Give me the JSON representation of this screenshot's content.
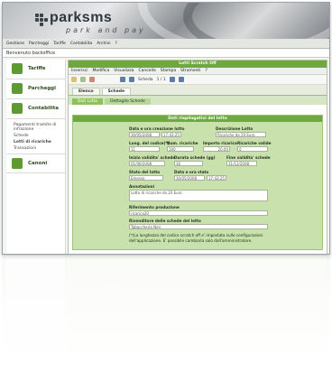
{
  "app": {
    "brand_name": "parksms",
    "tagline": "park and pay",
    "welcome": "Benvenuto backoffice"
  },
  "menubar": {
    "items": [
      "Gestione",
      "Parcheggi",
      "Tariffe",
      "Contabilita",
      "Archivi",
      "?"
    ]
  },
  "sidebar": {
    "items": [
      {
        "label": "Tariffe",
        "icon": "tariff-icon"
      },
      {
        "label": "Parcheggi",
        "icon": "parking-icon"
      },
      {
        "label": "Contabilita",
        "icon": "accounting-icon"
      },
      {
        "label": "Canoni",
        "icon": "fees-icon"
      }
    ],
    "subitems": [
      "Pagamenti tramite di infrazione",
      "Schede",
      "Lotti di ricariche",
      "Transazioni"
    ]
  },
  "window": {
    "title": "Lotti Scratch Off",
    "menu": [
      "Inserisci",
      "Modifica",
      "Visualizza",
      "Cancella",
      "Stampa",
      "Strumenti",
      "?"
    ],
    "record_label": "Scheda",
    "record_position": "1 / 1",
    "tabs": [
      "Elenco",
      "Schede"
    ],
    "subtabs": [
      "Dati Lotto",
      "Dettaglio Schede"
    ]
  },
  "form": {
    "section_title": "Dati riepilogativi del lotto",
    "fields": {
      "created_label": "Data e ora creazione lotto",
      "created_date": "30/05/2008",
      "created_time": "17:43:25",
      "description_label": "Descrizione Lotto",
      "description_value": "Ricariche da 20 Euro",
      "code_length_label": "Lung. del codice(*)",
      "code_length_value": "11",
      "num_recharges_label": "Num. ricariche",
      "num_recharges_value": "100",
      "amount_label": "Importo ricarica",
      "amount_value": "20,00",
      "validity_label": "Ricariche valide",
      "validity_value": "0",
      "start_label": "Inizio validita' schede",
      "start_value": "01/06/2008",
      "duration_label": "Durata schede (gg)",
      "duration_value": "30",
      "end_label": "Fine validita' schede",
      "end_value": "31/12/2008",
      "status_label": "Stato del lotto",
      "status_value": "Emesso",
      "status_date_label": "Data e ora stato",
      "status_date": "30/05/2008",
      "status_time": "17:43:25",
      "notes_label": "Annotazioni",
      "notes_value": "Lotto di ricariche da 20 Euro",
      "production_ref_label": "Riferimento produzione",
      "production_ref_value": "ricarica20",
      "card_seller_label": "Rivenditore delle schede del lotto",
      "card_seller_value": "Tabaccheria Neri"
    },
    "footnote_1": "(*)La lunghezza del codice scratch off e' impostata sulle configurazioni",
    "footnote_2": "dell'applicazione. E' possibile cambiarla solo dall'amministratore."
  },
  "colors": {
    "accent_green": "#6fa83f",
    "form_bg": "#c9e2ad"
  }
}
